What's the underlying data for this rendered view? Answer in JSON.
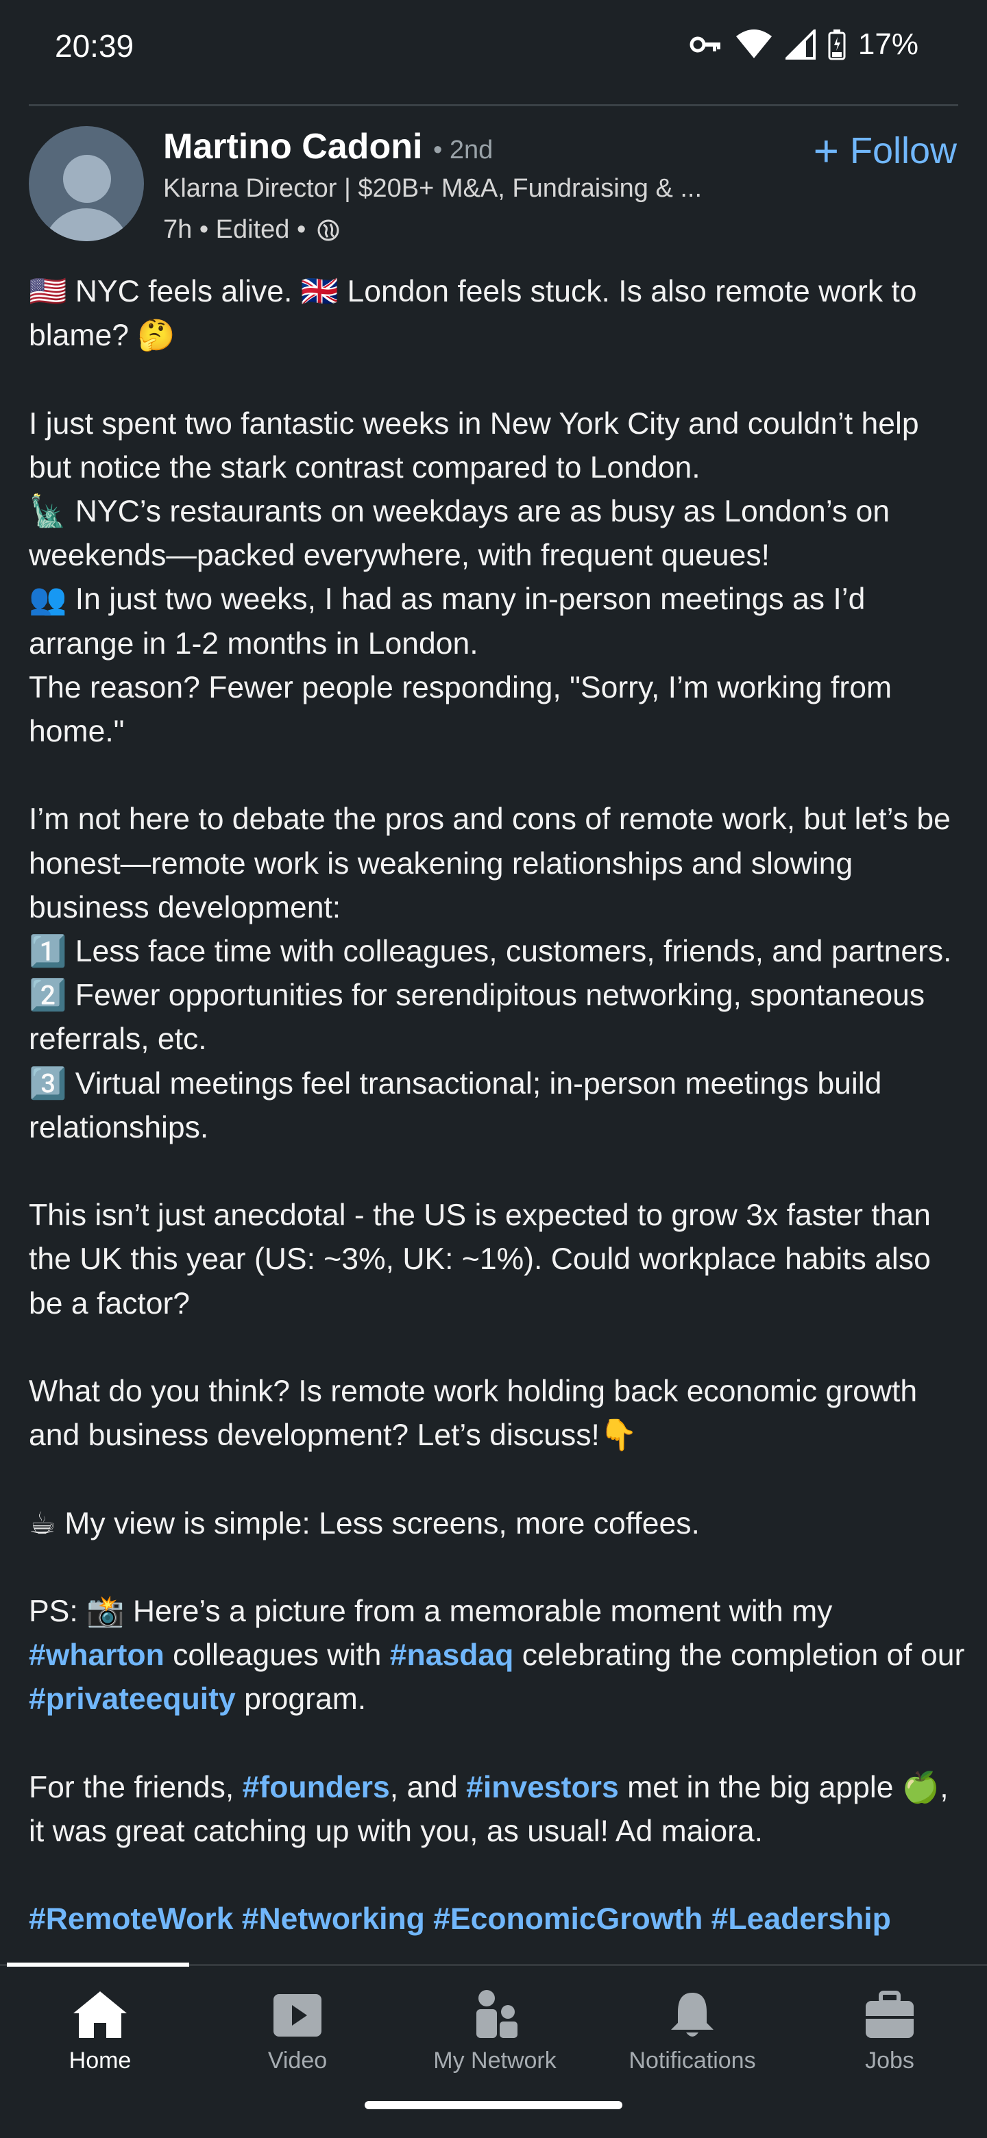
{
  "status": {
    "time": "20:39",
    "battery": "17%"
  },
  "post": {
    "author": "Martino Cadoni",
    "degree": "• 2nd",
    "headline": "Klarna Director | $20B+ M&A, Fundraising & ...",
    "meta": "7h • Edited •",
    "follow_label": "Follow",
    "paragraphs": {
      "p1": "🇺🇸 NYC feels alive. 🇬🇧 London feels stuck. Is also remote work to blame? 🤔",
      "p2": "I just spent two fantastic weeks in New York City and couldn’t help but notice the stark contrast compared to London.",
      "p3": "🗽 NYC’s restaurants on weekdays are as busy as London’s on weekends—packed everywhere, with frequent queues!",
      "p4": "👥 In just two weeks, I had as many in-person meetings as I’d arrange in 1-2 months in London.",
      "p5": "The reason? Fewer people responding, \"Sorry, I’m working from home.\"",
      "p6": "I’m not here to debate the pros and cons of remote work, but let’s be honest—remote work is weakening relationships and slowing business development:",
      "p7": "1️⃣ Less face time with colleagues, customers, friends, and partners.",
      "p8": "2️⃣ Fewer opportunities for serendipitous networking, spontaneous referrals, etc.",
      "p9": "3️⃣ Virtual meetings feel transactional; in-person meetings build relationships.",
      "p10": "This isn’t just anecdotal - the US is expected to grow 3x faster than the UK this year (US: ~3%, UK: ~1%). Could workplace habits also be a factor?",
      "p11": "What do you think? Is remote work holding back economic growth and business development? Let’s discuss!👇",
      "p12": "☕ My view is simple: Less screens, more coffees.",
      "p13a": "PS: 📸 Here’s a picture from a memorable moment with my ",
      "p13_tag1": "#wharton",
      "p13b": " colleagues with ",
      "p13_tag2": "#nasdaq",
      "p13c": " celebrating the completion of our ",
      "p13_tag3": "#privateequity",
      "p13d": " program.",
      "p14a": "For the friends, ",
      "p14_tag1": "#founders",
      "p14b": ", and ",
      "p14_tag2": "#investors",
      "p14c": " met in the big apple 🍏, it was great catching up with you, as usual! Ad maiora.",
      "hashtags": "#RemoteWork #Networking #EconomicGrowth #Leadership"
    }
  },
  "nav": {
    "items": [
      {
        "label": "Home",
        "icon": "home-icon"
      },
      {
        "label": "Video",
        "icon": "video-icon"
      },
      {
        "label": "My Network",
        "icon": "network-icon"
      },
      {
        "label": "Notifications",
        "icon": "bell-icon"
      },
      {
        "label": "Jobs",
        "icon": "briefcase-icon"
      }
    ]
  },
  "colors": {
    "background": "#1d2226",
    "link": "#71b7fb",
    "text": "#f2f2f2"
  }
}
